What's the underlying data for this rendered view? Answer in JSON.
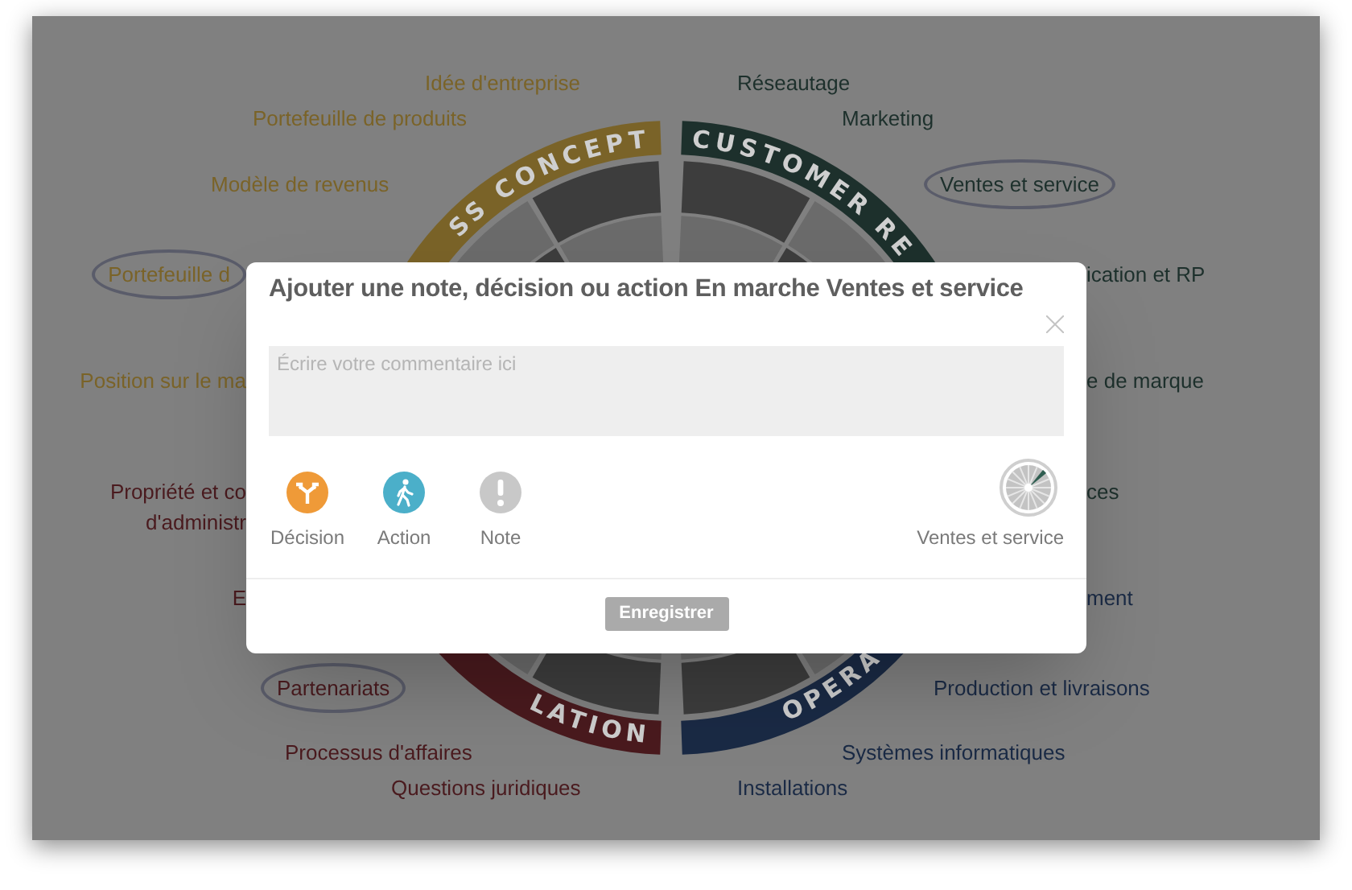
{
  "wheel": {
    "segments": [
      {
        "label": "SS CONCEPT",
        "color": "#7a6328"
      },
      {
        "label": "CUSTOMER RE",
        "color": "#1d302c"
      },
      {
        "label": "OPERA",
        "color": "#1a2a45"
      },
      {
        "label": "LATION",
        "color": "#4a1a1e"
      }
    ]
  },
  "topics": [
    {
      "lines": [
        "Idée d'entreprise"
      ],
      "color": "#7a6328",
      "circled": false
    },
    {
      "lines": [
        "Portefeuille de produits"
      ],
      "color": "#7a6328",
      "circled": false
    },
    {
      "lines": [
        "Modèle de revenus"
      ],
      "color": "#7a6328",
      "circled": false
    },
    {
      "lines": [
        "Portefeuille d"
      ],
      "color": "#7a6328",
      "circled": true
    },
    {
      "lines": [
        "Position sur le ma"
      ],
      "color": "#7a6328",
      "circled": false
    },
    {
      "lines": [
        "Propriété et co",
        "d'administr"
      ],
      "color": "#4a1a1e",
      "circled": false
    },
    {
      "lines": [
        "E"
      ],
      "color": "#4a1a1e",
      "circled": false
    },
    {
      "lines": [
        "Partenariats"
      ],
      "color": "#4a1a1e",
      "circled": true
    },
    {
      "lines": [
        "Processus d'affaires"
      ],
      "color": "#4a1a1e",
      "circled": false
    },
    {
      "lines": [
        "Questions juridiques"
      ],
      "color": "#4a1a1e",
      "circled": false
    },
    {
      "lines": [
        "Réseautage"
      ],
      "color": "#1d302c",
      "circled": false
    },
    {
      "lines": [
        "Marketing"
      ],
      "color": "#1d302c",
      "circled": false
    },
    {
      "lines": [
        "Ventes et service"
      ],
      "color": "#1d302c",
      "circled": true
    },
    {
      "lines": [
        "ication et RP"
      ],
      "color": "#1d302c",
      "circled": false
    },
    {
      "lines": [
        "e de marque"
      ],
      "color": "#1d302c",
      "circled": false
    },
    {
      "lines": [
        "ces"
      ],
      "color": "#1d302c",
      "circled": false
    },
    {
      "lines": [
        "ment"
      ],
      "color": "#1a2a45",
      "circled": false
    },
    {
      "lines": [
        "Production et livraisons"
      ],
      "color": "#1a2a45",
      "circled": false
    },
    {
      "lines": [
        "Systèmes informatiques"
      ],
      "color": "#1a2a45",
      "circled": false
    },
    {
      "lines": [
        "Installations"
      ],
      "color": "#1a2a45",
      "circled": false
    }
  ],
  "dialog": {
    "title": "Ajouter une note, décision ou action En marche Ventes et service",
    "comment": {
      "placeholder": "Écrire votre commentaire ici"
    },
    "types": [
      {
        "label": "Décision",
        "kind": "decision",
        "color": "#ef9a38"
      },
      {
        "label": "Action",
        "kind": "action",
        "color": "#4bafc9"
      },
      {
        "label": "Note",
        "kind": "note",
        "color": "#c8c8c8"
      }
    ],
    "topic": {
      "label": "Ventes et service"
    },
    "save_button": "Enregistrer"
  }
}
